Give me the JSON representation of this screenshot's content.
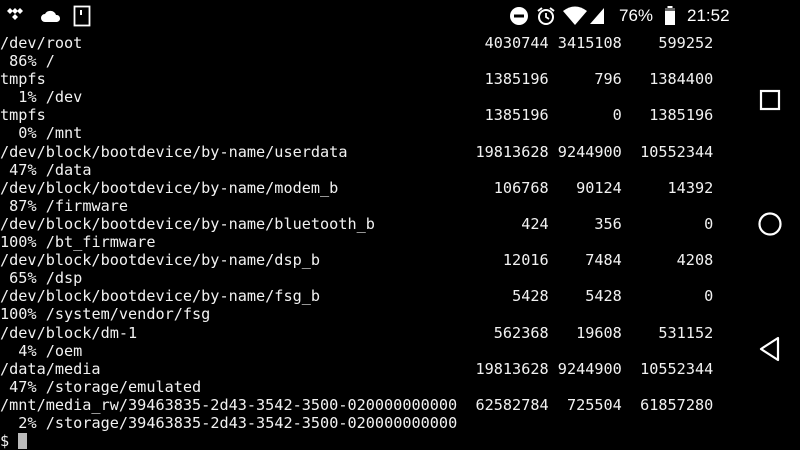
{
  "status_bar": {
    "left_icons": [
      "tidal-icon",
      "cloud-icon",
      "sim-card-icon"
    ],
    "right_icons": [
      "do-not-disturb-icon",
      "alarm-icon",
      "wifi-icon",
      "cellular-signal-icon",
      "battery-icon"
    ],
    "battery": "76%",
    "time": "21:52"
  },
  "terminal": {
    "rows": [
      {
        "filesystem": "/dev/root",
        "size": "4030744",
        "used": "3415108",
        "available": "599252",
        "use": "86%",
        "mounted_on": "/"
      },
      {
        "filesystem": "tmpfs",
        "size": "1385196",
        "used": "796",
        "available": "1384400",
        "use": "1%",
        "mounted_on": "/dev"
      },
      {
        "filesystem": "tmpfs",
        "size": "1385196",
        "used": "0",
        "available": "1385196",
        "use": "0%",
        "mounted_on": "/mnt"
      },
      {
        "filesystem": "/dev/block/bootdevice/by-name/userdata",
        "size": "19813628",
        "used": "9244900",
        "available": "10552344",
        "use": "47%",
        "mounted_on": "/data"
      },
      {
        "filesystem": "/dev/block/bootdevice/by-name/modem_b",
        "size": "106768",
        "used": "90124",
        "available": "14392",
        "use": "87%",
        "mounted_on": "/firmware"
      },
      {
        "filesystem": "/dev/block/bootdevice/by-name/bluetooth_b",
        "size": "424",
        "used": "356",
        "available": "0",
        "use": "100%",
        "mounted_on": "/bt_firmware"
      },
      {
        "filesystem": "/dev/block/bootdevice/by-name/dsp_b",
        "size": "12016",
        "used": "7484",
        "available": "4208",
        "use": "65%",
        "mounted_on": "/dsp"
      },
      {
        "filesystem": "/dev/block/bootdevice/by-name/fsg_b",
        "size": "5428",
        "used": "5428",
        "available": "0",
        "use": "100%",
        "mounted_on": "/system/vendor/fsg"
      },
      {
        "filesystem": "/dev/block/dm-1",
        "size": "562368",
        "used": "19608",
        "available": "531152",
        "use": "4%",
        "mounted_on": "/oem"
      },
      {
        "filesystem": "/data/media",
        "size": "19813628",
        "used": "9244900",
        "available": "10552344",
        "use": "47%",
        "mounted_on": "/storage/emulated"
      },
      {
        "filesystem": "/mnt/media_rw/39463835-2d43-3542-3500-020000000000",
        "size": "62582784",
        "used": "725504",
        "available": "61857280",
        "use": "2%",
        "mounted_on": "/storage/39463835-2d43-3542-3500-020000000000"
      }
    ],
    "prompt": "$ "
  },
  "nav_bar": {
    "icons": [
      "recents-square-icon",
      "home-circle-icon",
      "back-triangle-icon"
    ]
  }
}
